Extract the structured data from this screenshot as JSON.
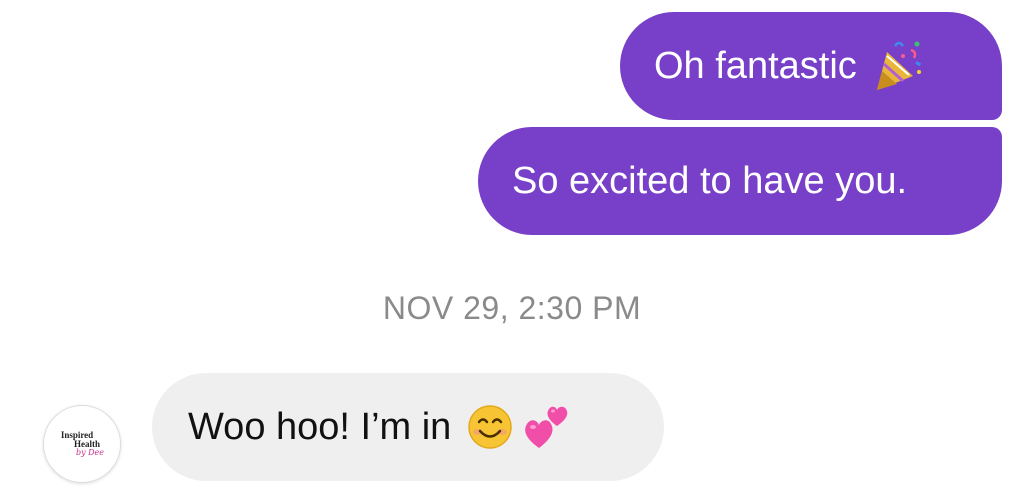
{
  "conversation": {
    "messages_sent": [
      {
        "text": "Oh fantastic",
        "emoji": "party-popper-icon"
      },
      {
        "text": "So excited to have you."
      }
    ],
    "timestamp": "NOV 29, 2:30 PM",
    "messages_received": [
      {
        "text": "Woo hoo! I’m in",
        "emojis": [
          "smiling-face-icon",
          "two-hearts-icon"
        ]
      }
    ],
    "sender_avatar": {
      "line1": "Inspired",
      "line2": "Health",
      "line3": "by Dee"
    }
  },
  "colors": {
    "sent_bubble": "#7840c8",
    "received_bubble": "#efefef",
    "timestamp_text": "#8a8a8a"
  }
}
